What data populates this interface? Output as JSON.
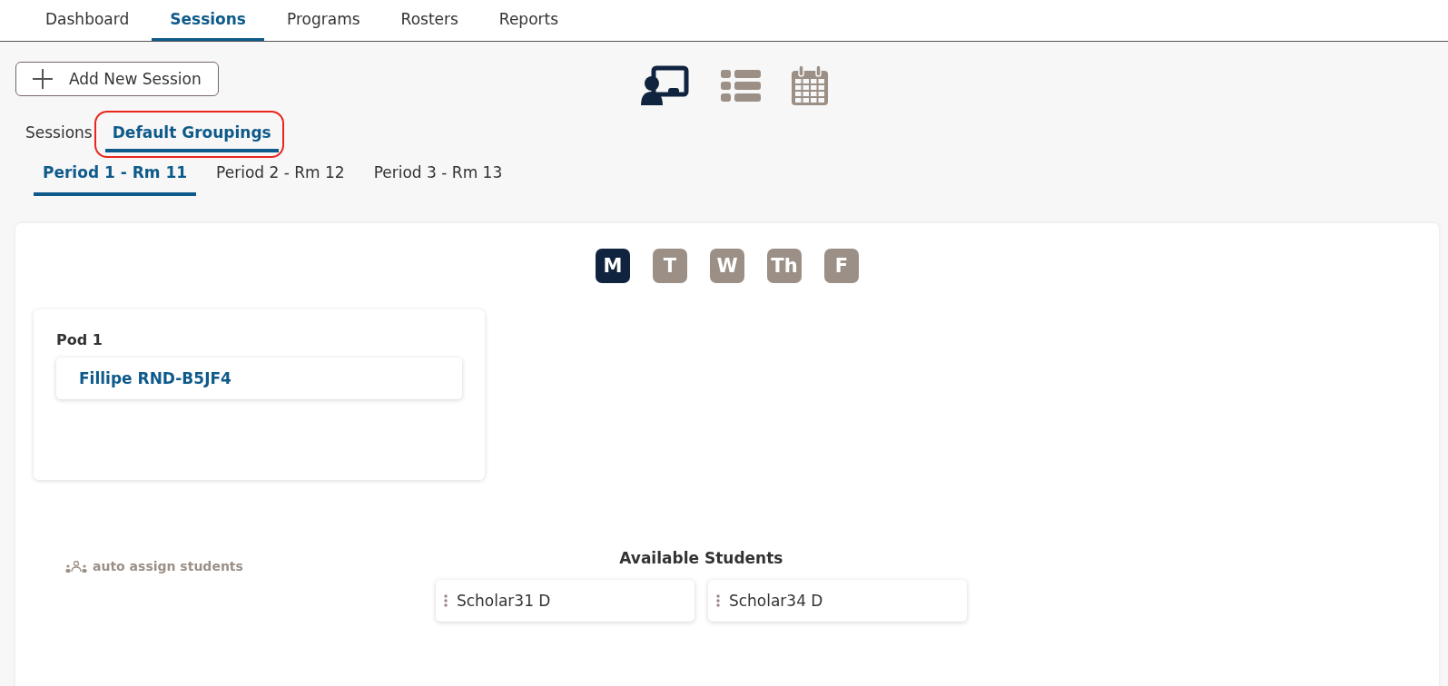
{
  "nav": [
    {
      "label": "Dashboard",
      "selected": false
    },
    {
      "label": "Sessions",
      "selected": true
    },
    {
      "label": "Programs",
      "selected": false
    },
    {
      "label": "Rosters",
      "selected": false
    },
    {
      "label": "Reports",
      "selected": false
    }
  ],
  "add_button": {
    "label": "Add New Session"
  },
  "views": [
    {
      "kind": "teacher",
      "selected": true
    },
    {
      "kind": "list",
      "selected": false
    },
    {
      "kind": "calendar",
      "selected": false
    }
  ],
  "sub_tabs": [
    {
      "label": "Sessions",
      "selected": false,
      "highlighted": false
    },
    {
      "label": "Default Groupings",
      "selected": true,
      "highlighted": true
    }
  ],
  "periods": [
    {
      "label": "Period 1 - Rm 11",
      "selected": true
    },
    {
      "label": "Period 2 - Rm 12",
      "selected": false
    },
    {
      "label": "Period 3 - Rm 13",
      "selected": false
    }
  ],
  "days": [
    {
      "label": "M",
      "selected": true
    },
    {
      "label": "T",
      "selected": false
    },
    {
      "label": "W",
      "selected": false
    },
    {
      "label": "Th",
      "selected": false
    },
    {
      "label": "F",
      "selected": false
    }
  ],
  "pods": [
    {
      "title": "Pod 1",
      "students": [
        "Fillipe RND-B5JF4"
      ]
    }
  ],
  "auto_assign": {
    "label": "auto assign students"
  },
  "available": {
    "title": "Available Students",
    "students": [
      "Scholar31 D",
      "Scholar34 D"
    ]
  }
}
